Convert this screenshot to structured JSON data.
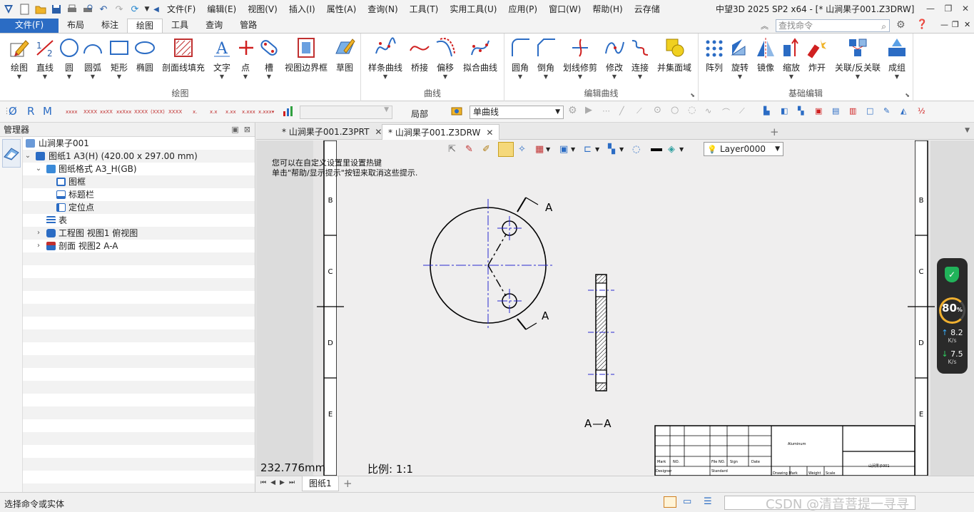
{
  "title_bar": {
    "menus": [
      "文件(F)",
      "编辑(E)",
      "视图(V)",
      "插入(I)",
      "属性(A)",
      "查询(N)",
      "工具(T)",
      "实用工具(U)",
      "应用(P)",
      "窗口(W)",
      "帮助(H)",
      "云存储"
    ],
    "app_title": "中望3D 2025 SP2 x64 - [* 山涧果子001.Z3DRW]"
  },
  "ribbon_tabs": {
    "file": "文件(F)",
    "tabs": [
      "布局",
      "标注",
      "绘图",
      "工具",
      "查询",
      "管路"
    ],
    "active": "绘图",
    "search_placeholder": "查找命令"
  },
  "ribbon": {
    "groups": [
      {
        "label": "绘图",
        "buttons": [
          "绘图",
          "直线",
          "圆",
          "圆弧",
          "矩形",
          "椭圆",
          "剖面线填充",
          "文字",
          "点",
          "槽",
          "视图边界框",
          "草图"
        ]
      },
      {
        "label": "曲线",
        "buttons": [
          "样条曲线",
          "桥接",
          "偏移",
          "拟合曲线"
        ]
      },
      {
        "label": "编辑曲线",
        "buttons": [
          "圆角",
          "倒角",
          "划线修剪",
          "修改",
          "连接",
          "并集面域"
        ]
      },
      {
        "label": "基础编辑",
        "buttons": [
          "阵列",
          "旋转",
          "镜像",
          "缩放",
          "炸开",
          "关联/反关联",
          "成组"
        ]
      }
    ]
  },
  "toolbar2": {
    "local_label": "局部",
    "curve_type": "单曲线"
  },
  "manager": {
    "title": "管理器",
    "tree": [
      {
        "label": "山涧果子001",
        "level": 0,
        "toggle": "",
        "icon": "part-icon"
      },
      {
        "label": "图纸1 A3(H) (420.00 x 297.00 mm)",
        "level": 0,
        "toggle": "v",
        "icon": "sheet-icon"
      },
      {
        "label": "图纸格式 A3_H(GB)",
        "level": 1,
        "toggle": "v",
        "icon": "format-icon"
      },
      {
        "label": "图框",
        "level": 2,
        "toggle": "",
        "icon": "frame-icon"
      },
      {
        "label": "标题栏",
        "level": 2,
        "toggle": "",
        "icon": "titleblock-icon"
      },
      {
        "label": "定位点",
        "level": 2,
        "toggle": "",
        "icon": "anchor-icon"
      },
      {
        "label": "表",
        "level": 1,
        "toggle": "",
        "icon": "table-icon"
      },
      {
        "label": "工程图 视图1 俯视图",
        "level": 1,
        "toggle": ">",
        "icon": "view-icon"
      },
      {
        "label": "剖面 视图2 A-A",
        "level": 1,
        "toggle": ">",
        "icon": "section-icon"
      }
    ]
  },
  "doc_tabs": {
    "tabs": [
      {
        "label": "* 山涧果子001.Z3PRT",
        "active": false
      },
      {
        "label": "* 山涧果子001.Z3DRW",
        "active": true
      }
    ]
  },
  "drawing": {
    "hint_lines": [
      "您可以在自定义设置里设置热键",
      "单击\"帮助/显示提示\"按钮来取消这些提示."
    ],
    "layer": "Layer0000",
    "zone_letters_left": [
      "B",
      "C",
      "D",
      "E"
    ],
    "zone_letters_right": [
      "B",
      "C",
      "D",
      "E"
    ],
    "section_label": "A",
    "section_title": "A—A",
    "length_readout": "232.776mm",
    "scale": "比例:   1:1",
    "title_block": {
      "material": "Aluminum",
      "row_labels": [
        "Mark",
        "NO.",
        "File NO.",
        "Sign",
        "Date"
      ],
      "bottom_labels": [
        "Designer",
        "Standard",
        "Drawing Mark",
        "Weight",
        "Scale"
      ],
      "drawing_no": "山涧果子001"
    }
  },
  "sheet_tabs": {
    "active": "图纸1"
  },
  "status_bar": {
    "text": "选择命令或实体",
    "watermark": "CSDN @清音菩提一寻寻"
  },
  "net_widget": {
    "percent": "80",
    "percent_unit": "%",
    "upload": "8.2",
    "download": "7.5",
    "unit": "K/s"
  },
  "colors": {
    "accent": "#2b6cc4",
    "centerline": "#2a2ad0",
    "sheet_bg": "#e7e6e6"
  }
}
